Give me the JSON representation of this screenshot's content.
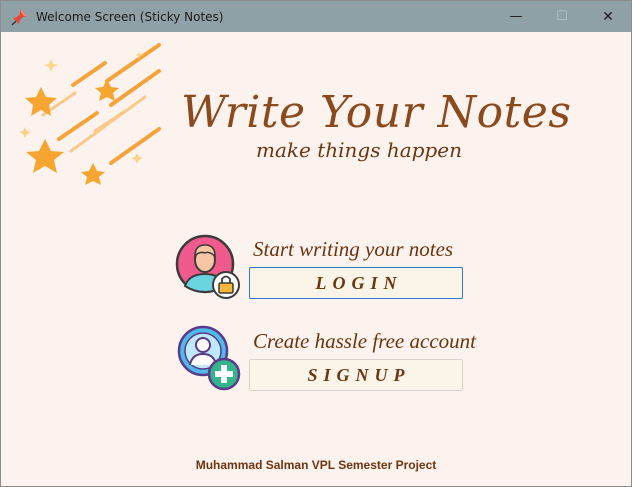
{
  "window": {
    "title": "Welcome Screen (Sticky Notes)",
    "controls": {
      "minimize": "—",
      "maximize": "☐",
      "close": "✕"
    },
    "icon": "pushpin-app-icon"
  },
  "hero": {
    "headline": "Write Your Notes",
    "tagline": "make things happen",
    "decoration": "shooting-stars-illustration"
  },
  "login": {
    "caption": "Start writing your notes",
    "button_label": "LOGIN",
    "icon": "user-lock-icon"
  },
  "signup": {
    "caption": "Create hassle free account",
    "button_label": "SIGNUP",
    "icon": "user-add-icon"
  },
  "footer": {
    "text": "Muhammad Salman VPL Semester Project"
  },
  "colors": {
    "accent_brown": "#8b4a1e",
    "background": "#fdf3ee",
    "titlebar": "#8fa0a6",
    "star_orange": "#f6a33c",
    "login_avatar": "#f05a8c",
    "signup_avatar": "#4fb9e9"
  }
}
